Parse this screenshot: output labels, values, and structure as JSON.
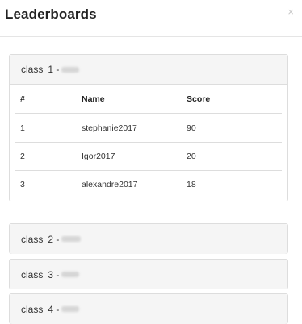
{
  "modal": {
    "title": "Leaderboards",
    "close_symbol": "×"
  },
  "leaderboard": {
    "columns": [
      "#",
      "Name",
      "Score"
    ],
    "classes": [
      {
        "label": "class",
        "number": "1 -",
        "expanded": true,
        "rows": [
          {
            "rank": "1",
            "name": "stephanie2017",
            "score": "90"
          },
          {
            "rank": "2",
            "name": "Igor2017",
            "score": "20"
          },
          {
            "rank": "3",
            "name": "alexandre2017",
            "score": "18"
          }
        ]
      },
      {
        "label": "class",
        "number": "2 -",
        "expanded": false
      },
      {
        "label": "class",
        "number": "3 -",
        "expanded": false
      },
      {
        "label": "class",
        "number": "4 -",
        "expanded": false
      }
    ]
  }
}
